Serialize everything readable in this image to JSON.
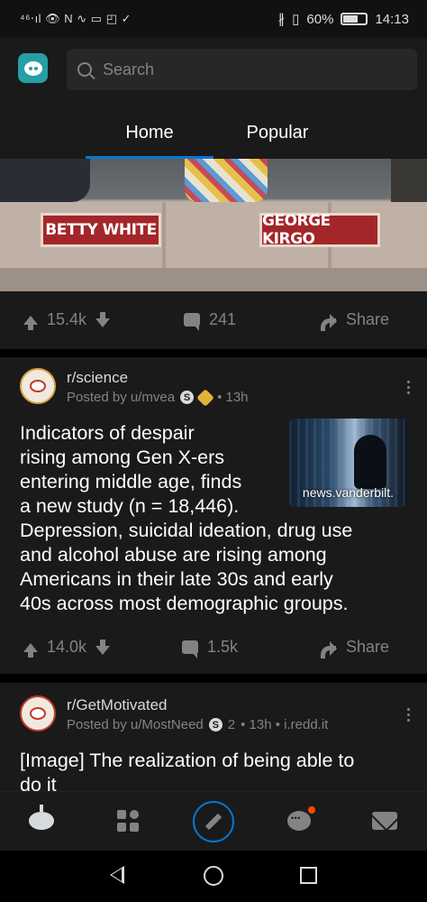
{
  "status_bar": {
    "left_indicators": "⁴⁶‧ıl 👁 N ∿ ▭ ◰ ✓",
    "bluetooth": "∦",
    "vibrate": "▯",
    "battery_percent": "60%",
    "time": "14:13"
  },
  "header": {
    "search_placeholder": "Search",
    "tabs": [
      {
        "label": "Home",
        "active": true
      },
      {
        "label": "Popular",
        "active": false
      }
    ],
    "accent_color": "#0079d3"
  },
  "post1": {
    "nameplates": [
      "BETTY WHITE",
      "GEORGE KIRGO"
    ],
    "upvotes": "15.4k",
    "comments": "241",
    "share_label": "Share"
  },
  "post2": {
    "subreddit": "r/science",
    "posted_by": "Posted by u/mvea",
    "badge": "S",
    "age": "• 13h",
    "title": "Indicators of despair rising among Gen X-ers entering middle age, finds a new study (n = 18,446). Depression, suicidal ideation, drug use and alcohol abuse are rising among Americans in their late 30s and early 40s across most demographic groups.",
    "title_lines": [
      "Indicators of despair",
      "rising among Gen X-ers",
      "entering middle age, finds",
      "a new study (n = 18,446).",
      "Depression, suicidal ideation, drug use",
      "and alcohol abuse are rising among",
      "Americans in their late 30s and early",
      "40s across most demographic groups."
    ],
    "thumbnail_domain": "news.vanderbilt.",
    "upvotes": "14.0k",
    "comments": "1.5k",
    "share_label": "Share"
  },
  "post3": {
    "subreddit": "r/GetMotivated",
    "posted_by": "Posted by u/MostNeed",
    "badge": "S",
    "badge_count": "2",
    "age": "• 13h • i.redd.it",
    "title_lines": [
      "[Image] The realization of being able to",
      "do it"
    ]
  },
  "bottom_nav": {
    "items": [
      "home-icon",
      "communities-icon",
      "create-post-icon",
      "chat-icon",
      "inbox-icon"
    ],
    "notification_color": "#ff4500"
  }
}
